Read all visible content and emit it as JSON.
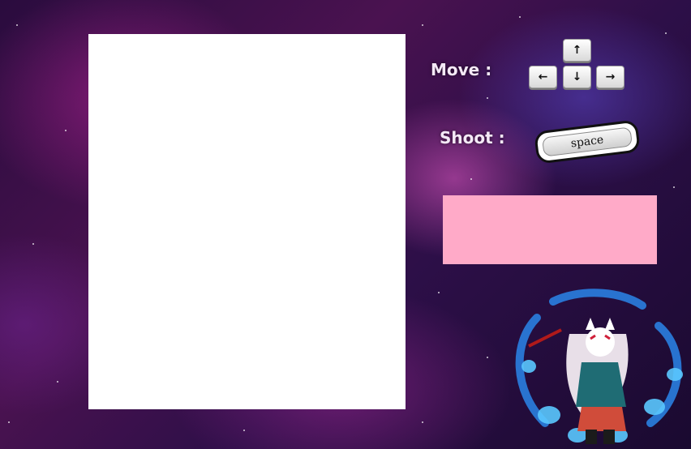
{
  "controls": {
    "move_label": "Move :",
    "shoot_label": "Shoot :",
    "keys": {
      "up": "↑",
      "left": "←",
      "down": "↓",
      "right": "→",
      "space": "space"
    }
  },
  "colors": {
    "game_area": "#ffffff",
    "status_panel": "#ffaac8",
    "label_text": "#f4e9f6"
  },
  "icons": {
    "character": "fox-mask-character-icon"
  }
}
